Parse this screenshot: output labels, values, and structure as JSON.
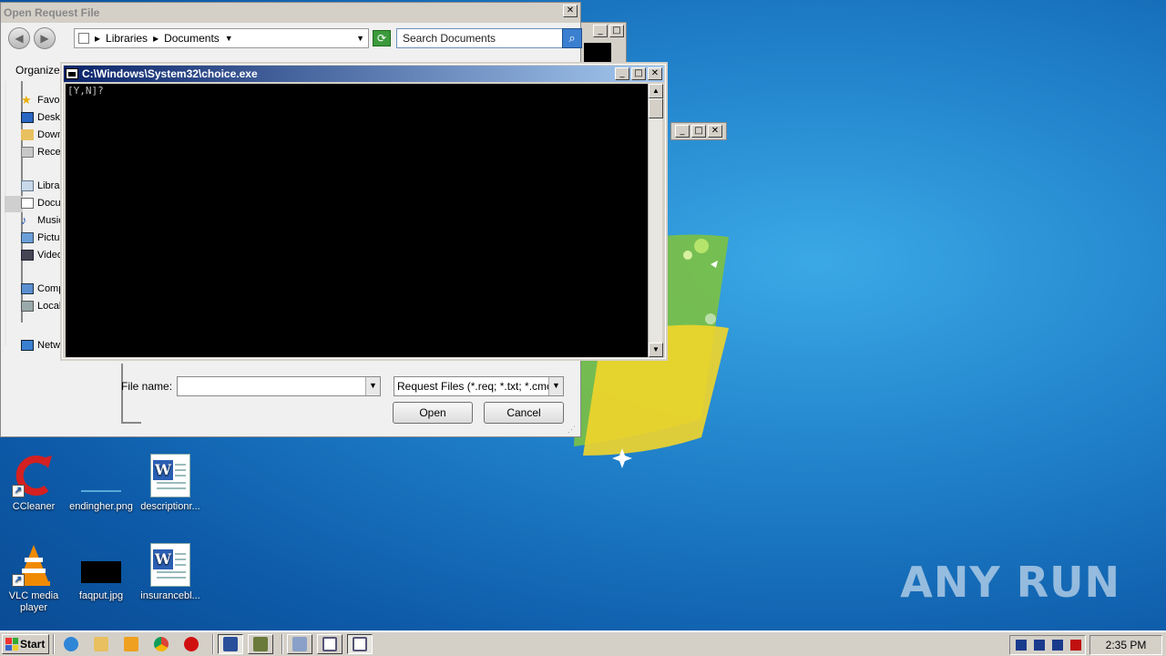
{
  "dialog": {
    "title": "Open Request File",
    "breadcrumb": [
      "Libraries",
      "Documents"
    ],
    "search_placeholder": "Search Documents",
    "organize_label": "Organize",
    "nav_items": [
      {
        "label": "Favorites",
        "icon": "star-icon"
      },
      {
        "label": "Desktop",
        "icon": "desktop-icon"
      },
      {
        "label": "Downloads",
        "icon": "downloads-icon"
      },
      {
        "label": "Recent Places",
        "icon": "recent-icon"
      },
      {
        "label": "Libraries",
        "icon": "library-icon"
      },
      {
        "label": "Documents",
        "icon": "documents-icon"
      },
      {
        "label": "Music",
        "icon": "music-icon"
      },
      {
        "label": "Pictures",
        "icon": "pictures-icon"
      },
      {
        "label": "Videos",
        "icon": "videos-icon"
      },
      {
        "label": "Computer",
        "icon": "computer-icon"
      },
      {
        "label": "Local Disk",
        "icon": "disk-icon"
      },
      {
        "label": "Network",
        "icon": "network-icon"
      }
    ],
    "filename_label": "File name:",
    "filename_value": "",
    "filetype_value": "Request Files (*.req; *.txt; *.cmc",
    "open_label": "Open",
    "cancel_label": "Cancel"
  },
  "console": {
    "title": "C:\\Windows\\System32\\choice.exe",
    "output": "[Y,N]?"
  },
  "desktop": {
    "icons": [
      {
        "label": "CCleaner",
        "icon": "ccleaner-icon"
      },
      {
        "label": "endingher.png",
        "icon": "image-file-icon"
      },
      {
        "label": "descriptionr...",
        "icon": "word-doc-icon"
      },
      {
        "label": "VLC media player",
        "icon": "vlc-icon"
      },
      {
        "label": "faqput.jpg",
        "icon": "image-file-icon"
      },
      {
        "label": "insurancebl...",
        "icon": "word-doc-icon"
      }
    ],
    "watermark": "ANY RUN"
  },
  "taskbar": {
    "start_label": "Start",
    "items": [
      {
        "icon": "ie-icon"
      },
      {
        "icon": "explorer-icon"
      },
      {
        "icon": "media-player-icon"
      },
      {
        "icon": "chrome-icon"
      },
      {
        "icon": "opera-icon"
      },
      {
        "icon": "notepad-icon"
      },
      {
        "icon": "app-icon"
      },
      {
        "icon": "cmd-icon"
      },
      {
        "icon": "window-icon"
      },
      {
        "icon": "window-icon"
      }
    ],
    "clock": "2:35 PM"
  },
  "colors": {
    "title_active": "#0a246a",
    "desktop_blue": "#1f7fc8",
    "classic_face": "#d4d0c8"
  }
}
